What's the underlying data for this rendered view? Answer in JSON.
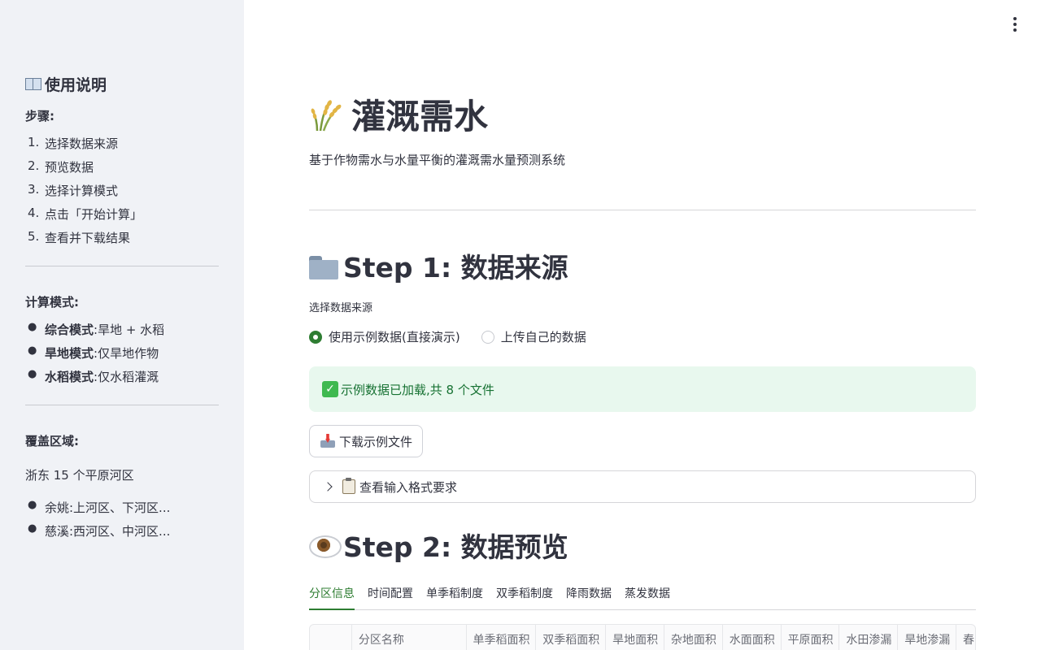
{
  "sidebar": {
    "heading": "使用说明",
    "steps_label": "步骤:",
    "steps": [
      {
        "num": "1.",
        "text": "选择数据来源"
      },
      {
        "num": "2.",
        "text": "预览数据"
      },
      {
        "num": "3.",
        "text": "选择计算模式"
      },
      {
        "num": "4.",
        "text": "点击「开始计算」"
      },
      {
        "num": "5.",
        "text": "查看并下载结果"
      }
    ],
    "modes_label": "计算模式:",
    "modes": [
      {
        "name": "综合模式",
        "desc": ":旱地 + 水稻"
      },
      {
        "name": "旱地模式",
        "desc": ":仅旱地作物"
      },
      {
        "name": "水稻模式",
        "desc": ":仅水稻灌溉"
      }
    ],
    "coverage_label": "覆盖区域:",
    "coverage_text": "浙东 15 个平原河区",
    "regions": [
      {
        "text": "余姚:上河区、下河区..."
      },
      {
        "text": "慈溪:西河区、中河区..."
      }
    ]
  },
  "main": {
    "title": "灌溉需水",
    "subtitle": "基于作物需水与水量平衡的灌溉需水量预测系统",
    "step1_title": "Step 1: 数据来源",
    "radio_label": "选择数据来源",
    "radio_options": [
      {
        "label": "使用示例数据(直接演示)",
        "selected": true
      },
      {
        "label": "上传自己的数据",
        "selected": false
      }
    ],
    "success_msg": "示例数据已加载,共 8 个文件",
    "download_label": "下载示例文件",
    "expander_label": "查看输入格式要求",
    "step2_title": "Step 2: 数据预览",
    "tabs": [
      "分区信息",
      "时间配置",
      "单季稻制度",
      "双季稻制度",
      "降雨数据",
      "蒸发数据"
    ],
    "active_tab": 0,
    "table_headers": [
      "",
      "分区名称",
      "单季稻面积",
      "双季稻面积",
      "旱地面积",
      "杂地面积",
      "水面面积",
      "平原面积",
      "水田渗漏",
      "旱地渗漏",
      "春"
    ]
  },
  "colors": {
    "accent": "#2e7d32",
    "success_bg": "#e8f8ee",
    "success_text": "#177233",
    "sidebar_bg": "#f0f2f6"
  },
  "icons": {
    "sidebar_heading": "open-book-icon",
    "title": "rice-sheaf-icon",
    "step1": "folder-icon",
    "step2": "eye-icon",
    "success": "check-mark-icon",
    "download": "inbox-tray-icon",
    "expander": "clipboard-icon",
    "menu": "kebab-menu-icon"
  }
}
